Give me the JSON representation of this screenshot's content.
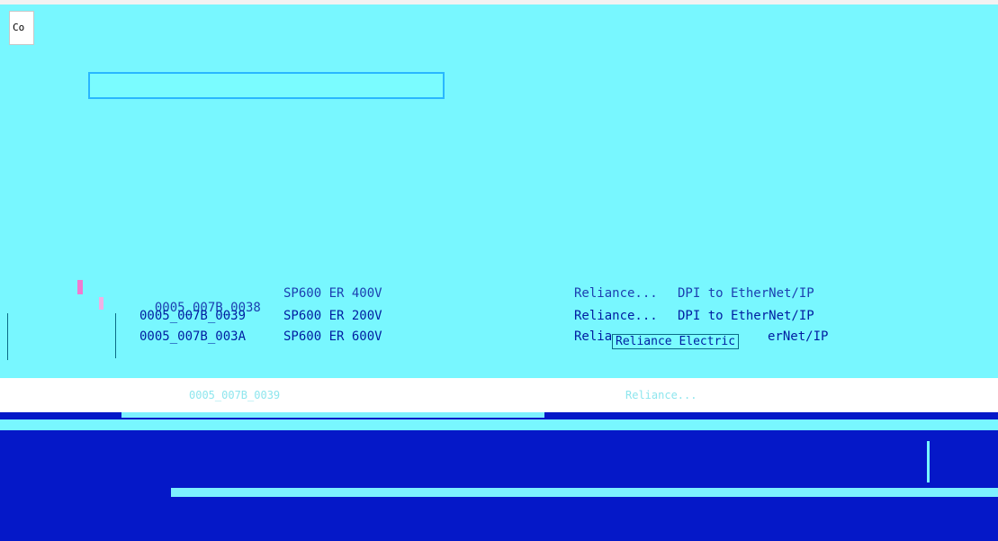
{
  "top": {
    "chip_label": "Co",
    "toolbar_label_left": "",
    "toolbar_label_right": ""
  },
  "list": {
    "rows": [
      {
        "id": "0005_007B_0038",
        "name": "SP600 ER 400V",
        "vendor": "Reliance...",
        "type": "DPI to EtherNet/IP"
      },
      {
        "id": "0005_007B_0039",
        "name": "SP600 ER 200V",
        "vendor": "Reliance...",
        "type": "DPI to EtherNet/IP"
      },
      {
        "id": "0005_007B_003A",
        "name": "SP600 ER 600V",
        "vendor": "Relia",
        "type": "erNet/IP"
      }
    ],
    "tooltip": "Reliance Electric",
    "faded_partial": "0005_007B_0039",
    "faded_partial_right": "Reliance..."
  },
  "bottom": {
    "line1": "",
    "line2": "",
    "line3": "",
    "right_label": ""
  }
}
